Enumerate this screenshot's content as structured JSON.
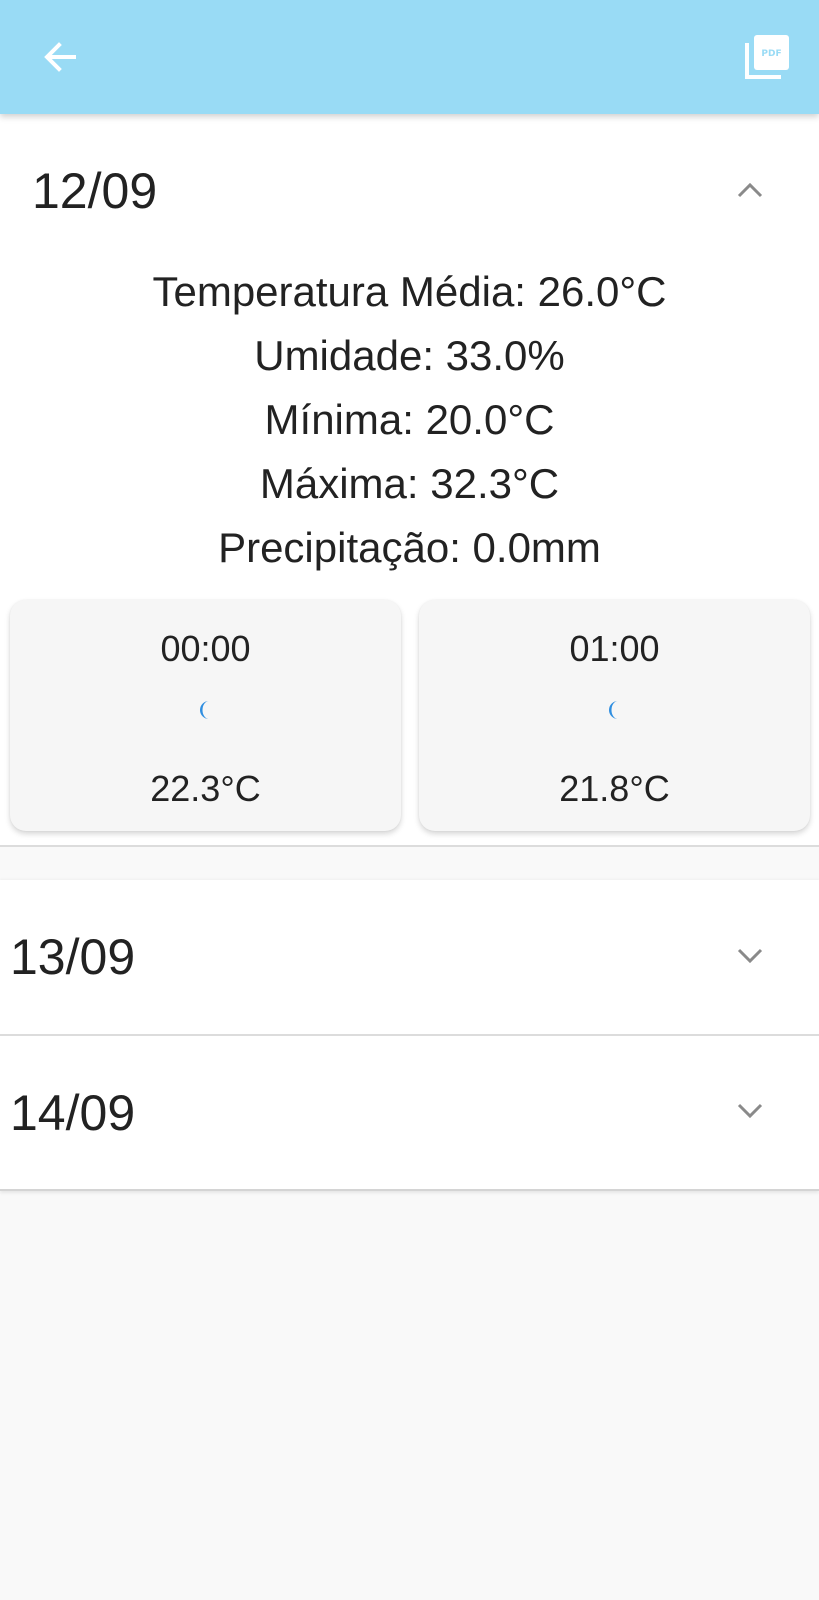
{
  "appbar": {
    "back_icon": "arrow-left-icon",
    "pdf_icon": "pdf-icon",
    "pdf_label": "PDF",
    "color": "#99dbf5"
  },
  "days": [
    {
      "date": "12/09",
      "expanded": true,
      "summary": {
        "temperatura": "Temperatura Média: 26.0°C",
        "umidade": "Umidade: 33.0%",
        "minima": "Mínima: 20.0°C",
        "maxima": "Máxima: 32.3°C",
        "precipitacao": "Precipitação: 0.0mm"
      },
      "hours": [
        {
          "time": "00:00",
          "icon": "moon-icon",
          "temp": "22.3°C"
        },
        {
          "time": "01:00",
          "icon": "moon-icon",
          "temp": "21.8°C"
        }
      ]
    },
    {
      "date": "13/09",
      "expanded": false
    },
    {
      "date": "14/09",
      "expanded": false
    }
  ],
  "colors": {
    "icon_blue": "#2f8ee0",
    "chevron": "#8a8a8a"
  }
}
